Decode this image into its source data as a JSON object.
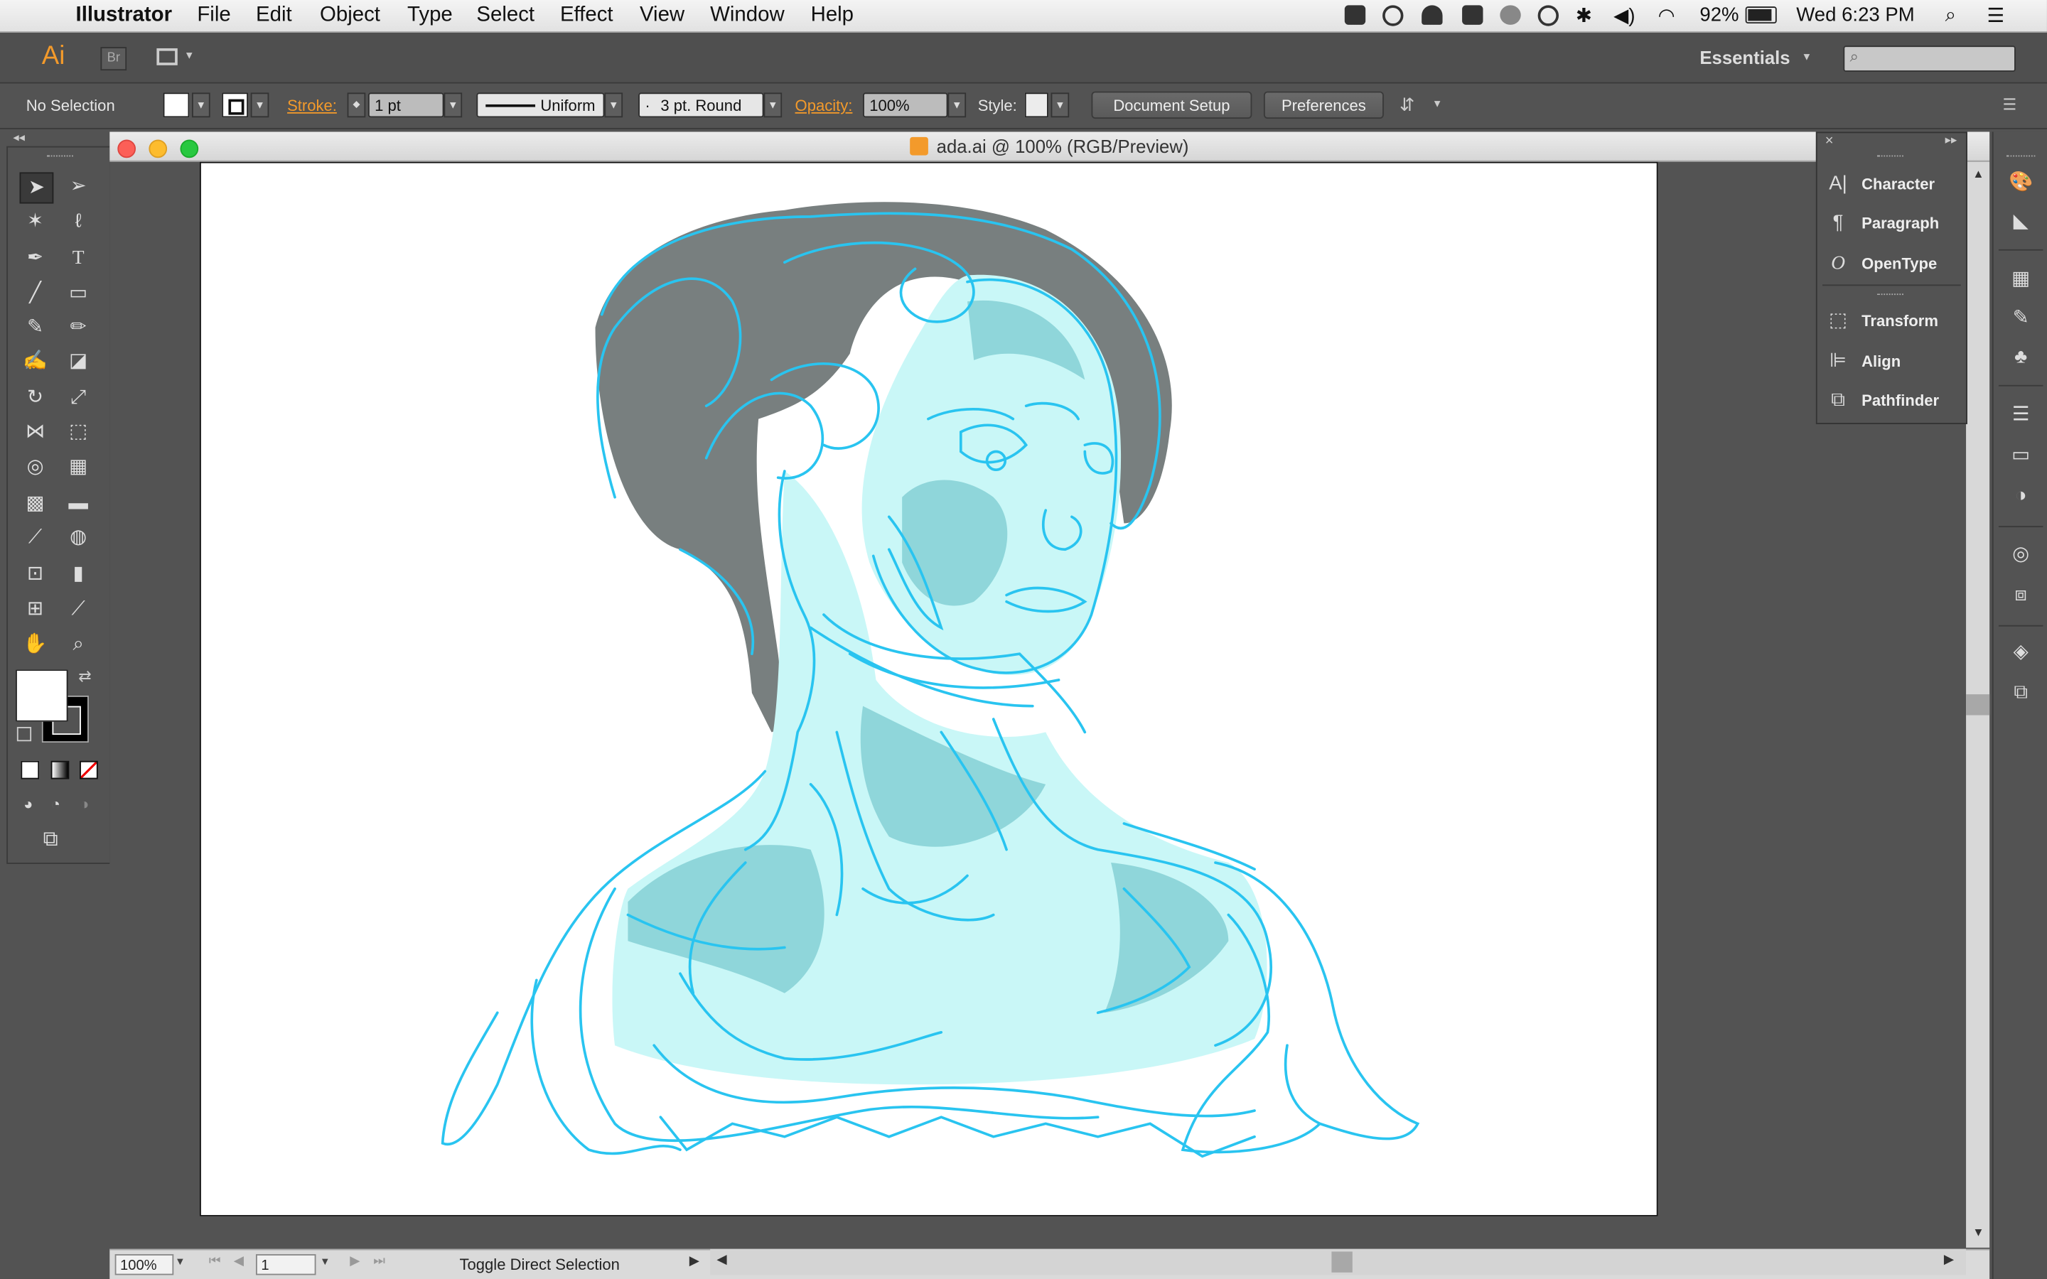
{
  "menubar": {
    "app": "Illustrator",
    "items": [
      "File",
      "Edit",
      "Object",
      "Type",
      "Select",
      "Effect",
      "View",
      "Window",
      "Help"
    ],
    "battery": "92%",
    "clock": "Wed 6:23 PM"
  },
  "appbar": {
    "logo": "Ai",
    "bridge": "Br",
    "workspace": "Essentials",
    "search_placeholder": ""
  },
  "control": {
    "selection": "No Selection",
    "stroke_label": "Stroke:",
    "stroke_value": "1 pt",
    "profile": "Uniform",
    "brush": "3 pt. Round",
    "opacity_label": "Opacity:",
    "opacity_value": "100%",
    "style_label": "Style:",
    "doc_setup": "Document Setup",
    "preferences": "Preferences"
  },
  "document": {
    "title": "ada.ai @ 100% (RGB/Preview)"
  },
  "status": {
    "zoom": "100%",
    "page": "1",
    "tool_hint": "Toggle Direct Selection"
  },
  "panel": {
    "items": [
      {
        "label": "Character",
        "icon": "character-icon"
      },
      {
        "label": "Paragraph",
        "icon": "paragraph-icon"
      },
      {
        "label": "OpenType",
        "icon": "opentype-icon"
      },
      {
        "label": "Transform",
        "icon": "transform-icon"
      },
      {
        "label": "Align",
        "icon": "align-icon"
      },
      {
        "label": "Pathfinder",
        "icon": "pathfinder-icon"
      }
    ]
  },
  "colors": {
    "accent": "#f39a2b",
    "sketch_stroke": "#29c4f0",
    "skin_fill": "#c9f7f7",
    "shadow_fill": "#8fd6da",
    "hair_fill": "#787f7f"
  }
}
